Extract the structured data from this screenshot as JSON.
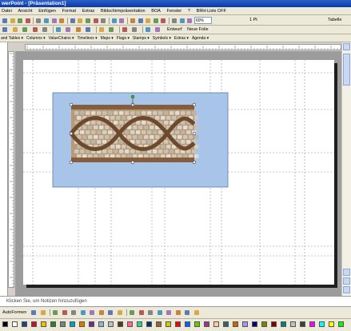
{
  "window": {
    "title": "werPoint - [Präsentation1]"
  },
  "menu": {
    "items": [
      "Datei",
      "Ansicht",
      "Einfügen",
      "Format",
      "Extras",
      "Bildschirmpräsentation",
      "BOA",
      "Fenster",
      "?",
      "BRH-Lists OFF"
    ]
  },
  "toolbar1": {
    "zoom_value": "60%",
    "design_label": "Entwurf",
    "new_slide_label": "Neue Folie",
    "line_weight": "1 Pt",
    "table_label": "Tabelle"
  },
  "toolbar3": {
    "items": [
      "and Tables",
      "Columns",
      "ValueChains",
      "Timelines",
      "Maps",
      "Flags",
      "Stamps",
      "Symbols",
      "Extras",
      "Agenda"
    ]
  },
  "notes": {
    "placeholder": "Klicken Sie, um Notizen hinzuzufügen"
  },
  "drawbar": {
    "autoshapes_label": "AutoFormen"
  },
  "colors": {
    "title_bar": "#0a3aa8",
    "picture_background": "#a8c4e8",
    "slide": "#ffffff",
    "workspace": "#9c9c9c",
    "toolbar": "#ece9d8",
    "rotation_handle": "#2fae2f"
  },
  "icons": {
    "toolbar1": [
      "new-icon",
      "open-icon",
      "save-icon",
      "permission-icon",
      "email-icon",
      "print-icon",
      "print-preview-icon",
      "spelling-icon",
      "research-icon",
      "cut-icon",
      "copy-icon",
      "paste-icon",
      "format-painter-icon",
      "undo-icon",
      "redo-icon",
      "hyperlink-icon",
      "insert-table-icon",
      "insert-chart-icon",
      "insert-picture-icon",
      "grid-icon",
      "expand-icon",
      "color-grayscale-icon",
      "zoom-icon",
      "help-icon"
    ],
    "toolbar2": [
      "font-icon",
      "bold-icon",
      "italic-icon",
      "underline-icon",
      "shadow-icon",
      "align-left-icon",
      "align-center-icon",
      "align-right-icon",
      "numbering-icon",
      "bullets-icon",
      "increase-font-icon",
      "decrease-font-icon",
      "decrease-indent-icon",
      "increase-indent-icon",
      "font-color-icon"
    ],
    "drawbar": [
      "select-arrow-icon",
      "line-icon",
      "arrow-icon",
      "rectangle-icon",
      "oval-icon",
      "textbox-icon",
      "wordart-icon",
      "diagram-icon",
      "clipart-icon",
      "picture-icon",
      "fill-color-icon",
      "line-color-icon",
      "font-color-icon",
      "line-style-icon",
      "dash-style-icon",
      "arrow-style-icon",
      "shadow-style-icon",
      "3d-style-icon"
    ]
  }
}
